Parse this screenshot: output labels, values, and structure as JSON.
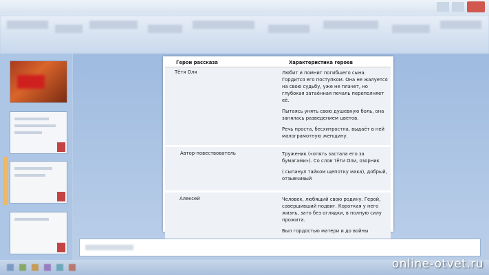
{
  "window": {
    "close_color": "#d0584e"
  },
  "slide_table": {
    "headers": {
      "hero": "Герои рассказа",
      "characteristic": "Характеристика героев"
    },
    "rows": [
      {
        "hero": "Тётя Оля",
        "characteristic": [
          "Любит и помнит погибшего сына. Гордится его поступком. Она не жалуется на свою судьбу, уже не плачет, но глубокая затаённая печаль переполняет её.",
          "Пытаясь унять свою душевную боль, она занялась разведением цветов.",
          "Речь проста, бесхитростна, выдаёт в ней малограмотную женщину."
        ]
      },
      {
        "hero": "Автор-повествователь",
        "characteristic": [
          "Труженик («опять застала его за бумагами»). Со слов тёти Оли, озорник",
          "( сыпанул тайком щепотку мака), добрый, отзывчивый"
        ]
      },
      {
        "hero": "Алексей",
        "characteristic": [
          "Человек, любящий свою родину. Герой, совершивший подвиг. Короткая у него жизнь, зато без оглядки, в полную силу прожита.",
          "Был гордостью матери и до войны"
        ]
      }
    ]
  },
  "watermark": {
    "text": "online-otvet.ru"
  },
  "colors": {
    "background": "#b9cde6",
    "slide": "#ffffff",
    "row_fill": "#eef1f6",
    "accent_orange": "#f0b860"
  }
}
